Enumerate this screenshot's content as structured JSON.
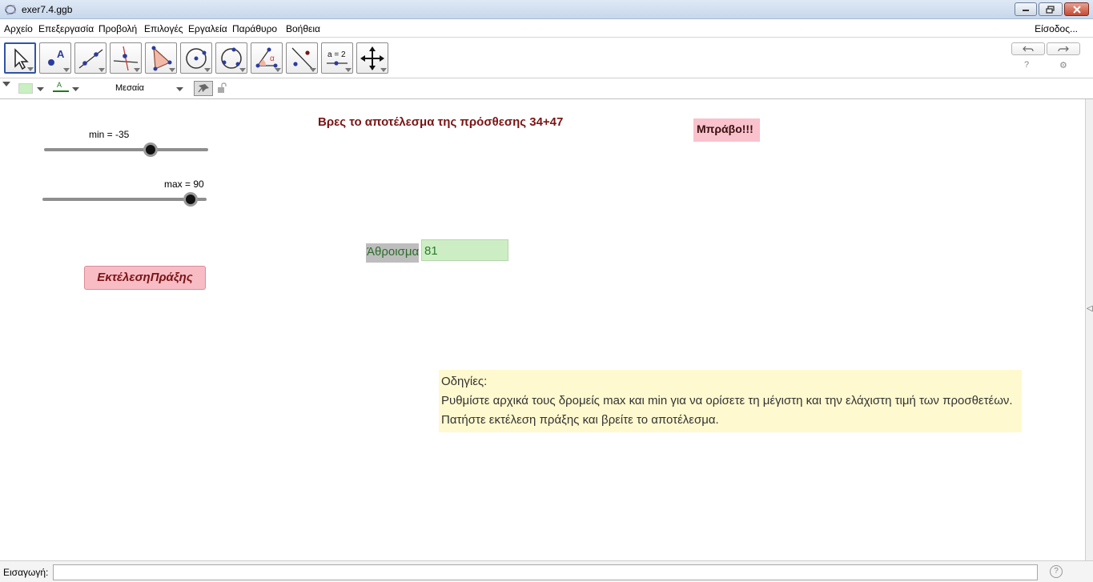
{
  "window": {
    "title": "exer7.4.ggb",
    "controls": [
      "minimize",
      "restore",
      "close"
    ]
  },
  "menu": {
    "items": [
      "Αρχείο",
      "Επεξεργασία",
      "Προβολή",
      "Επιλογές",
      "Εργαλεία",
      "Παράθυρο",
      "Βοήθεια"
    ],
    "signin": "Είσοδος..."
  },
  "toolbar": {
    "tools": [
      "move-tool",
      "point-tool",
      "line-tool",
      "perpendicular-line-tool",
      "polygon-tool",
      "circle-center-tool",
      "circle-three-points-tool",
      "angle-tool",
      "reflect-tool",
      "slider-tool",
      "move-graphics-tool"
    ],
    "slider_tool_text": "a = 2",
    "angle_symbol": "α",
    "point_letter": "A"
  },
  "stylebar": {
    "line_style_letter": "A",
    "size_option": "Μεσαία",
    "color_swatch": "#c8f0c0",
    "text_color": "#1e7a1e"
  },
  "graphics": {
    "slider_min": {
      "label": "min = -35",
      "value": -35,
      "range_min": -100,
      "range_max": 0
    },
    "slider_max": {
      "label": "max = 90",
      "value": 90,
      "range_min": 0,
      "range_max": 100
    },
    "headline": "Βρες το αποτέλεσμα της πρόσθεσης 34+47",
    "bravo": "Μπράβο!!!",
    "exec_button": "ΕκτέλεσηΠράξης",
    "sum_label": "Άθροισμα",
    "sum_value": "81",
    "instructions": [
      "Οδηγίες:",
      "Ρυθμίστε αρχικά τους δρομείς max και min για να ορίσετε τη μέγιστη και την ελάχιστη τιμή των προσθετέων.",
      "Πατήστε εκτέλεση πράξης και βρείτε το αποτέλεσμα."
    ]
  },
  "inputbar": {
    "label": "Εισαγωγή:",
    "value": "",
    "help": "?"
  }
}
